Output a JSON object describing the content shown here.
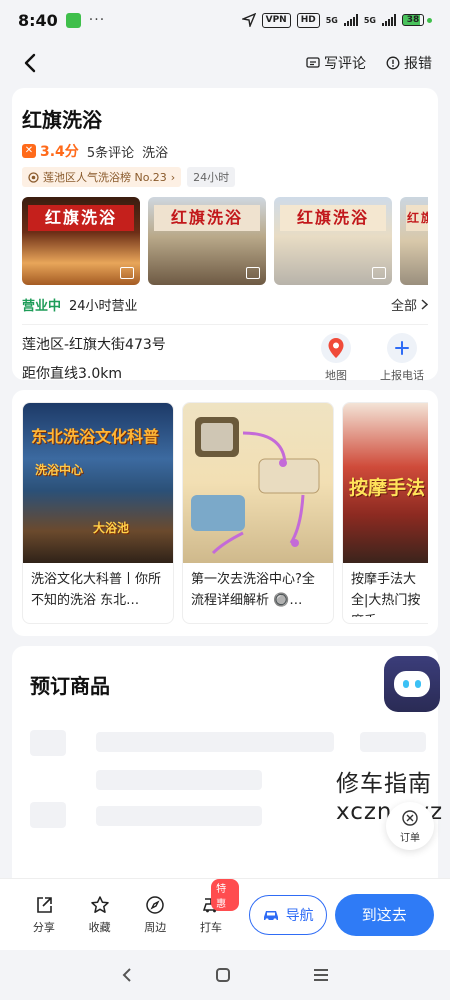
{
  "status": {
    "time": "8:40",
    "dots": "···",
    "vpn": "VPN",
    "hd": "HD",
    "net1": "5G",
    "net2": "5G",
    "battery": "38"
  },
  "top_bar": {
    "write_review": "写评论",
    "report_error": "报错"
  },
  "shop": {
    "name": "红旗洗浴",
    "rating": "3.4分",
    "reviews": "5条评论",
    "category": "洗浴",
    "rank_badge": "莲池区人气洗浴榜 No.23",
    "hours_badge": "24小时",
    "open_status": "营业中",
    "open_hours": "24小时营业",
    "all_link": "全部",
    "address": "莲池区-红旗大街473号",
    "distance": "距你直线3.0km",
    "map_label": "地图",
    "call_label": "上报电话"
  },
  "photos": [
    {
      "sign": "红旗洗浴"
    },
    {
      "sign": "红旗洗浴"
    },
    {
      "sign": "红旗洗浴"
    },
    {
      "sign": "红旗"
    }
  ],
  "articles": [
    {
      "caption": "洗浴文化大科普丨你所不知的洗浴 东北…",
      "thumb_title": "东北洗浴文化科普",
      "thumb_sub": "洗浴中心",
      "thumb_sub2": "大浴池"
    },
    {
      "caption": "第一次去洗浴中心?全流程详细解析 🔘…"
    },
    {
      "caption": "按摩手法大全|大热门按摩手",
      "thumb_title": "按摩手法"
    }
  ],
  "booking": {
    "title": "预订商品"
  },
  "watermark": {
    "line1": "修车指南",
    "line2": "xczn.xyz"
  },
  "order_label": "订单",
  "bottom_bar": {
    "share": "分享",
    "favorite": "收藏",
    "nearby": "周边",
    "taxi": "打车",
    "taxi_badge": "特惠",
    "navigate": "导航",
    "go_here": "到这去"
  },
  "colors": {
    "accent": "#2f7bf6",
    "rating": "#ff6a1a",
    "open": "#1e9c58"
  }
}
